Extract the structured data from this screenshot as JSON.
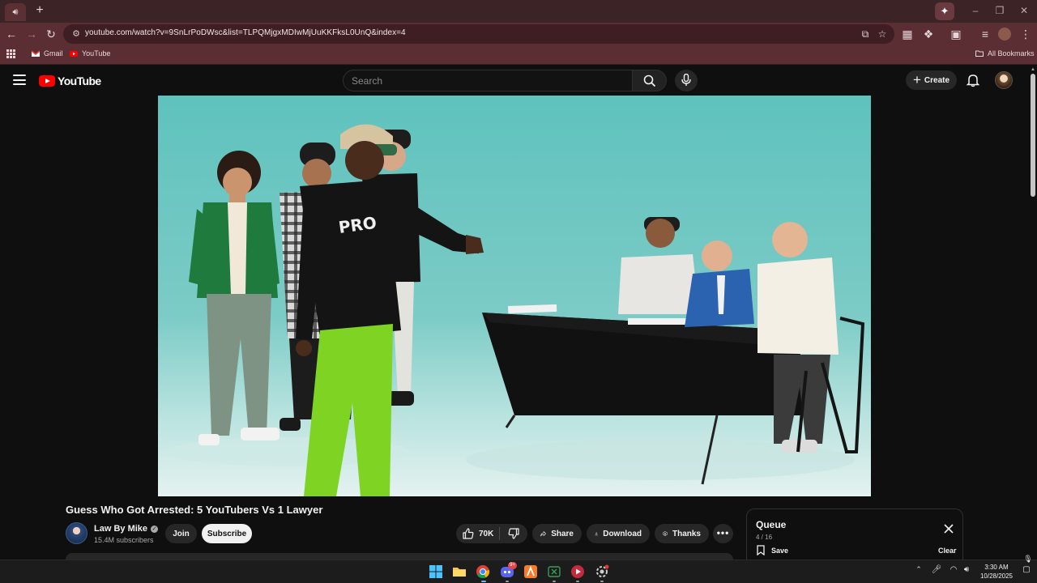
{
  "browser": {
    "tab_icon": "speaker-icon",
    "new_tab_label": "+",
    "url": "youtube.com/watch?v=9SnLrPoDWsc&list=TLPQMjgxMDIwMjUuKKFksL0UnQ&index=4",
    "bookmarks": [
      {
        "label": "Gmail",
        "icon": "gmail-icon"
      },
      {
        "label": "YouTube",
        "icon": "youtube-icon"
      }
    ],
    "all_bookmarks_label": "All Bookmarks"
  },
  "youtube": {
    "logo_text": "YouTube",
    "search_placeholder": "Search",
    "create_label": "Create"
  },
  "video": {
    "title": "Guess Who Got Arrested: 5 YouTubers Vs 1 Lawyer",
    "channel": "Law By Mike",
    "subscribers": "15.4M subscribers",
    "join_label": "Join",
    "subscribe_label": "Subscribe",
    "likes": "70K",
    "share_label": "Share",
    "download_label": "Download",
    "thanks_label": "Thanks",
    "more_label": "•••"
  },
  "queue": {
    "title": "Queue",
    "position": "4 / 16",
    "save_label": "Save",
    "clear_label": "Clear"
  },
  "taskbar": {
    "time": "3:30 AM",
    "date": "10/28/2025",
    "discord_badge": "9+"
  },
  "colors": {
    "youtube_red": "#ff0000",
    "chrome_frame": "#5a2e33",
    "page_bg": "#0f0f0f",
    "video_bg": "#5fc2bd"
  }
}
